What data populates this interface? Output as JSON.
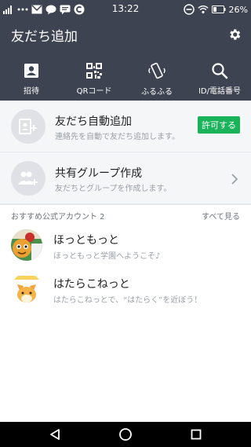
{
  "status_bar": {
    "time": "13:22",
    "battery": "26%",
    "left_icons": [
      "signal-icon",
      "more-dots-icon",
      "mail-icon",
      "chat-bubble-icon",
      "message-icon",
      "app-c-icon"
    ],
    "right_icons": [
      "minus-circle-icon",
      "wifi-icon",
      "battery-icon"
    ]
  },
  "header": {
    "title": "友だち追加",
    "settings_icon": "gear-icon",
    "nav": [
      {
        "label": "招待",
        "icon": "person-card-icon"
      },
      {
        "label": "QRコード",
        "icon": "qr-code-icon"
      },
      {
        "label": "ふるふる",
        "icon": "shake-phone-icon"
      },
      {
        "label": "ID/電話番号",
        "icon": "search-icon"
      }
    ]
  },
  "auto_add": {
    "title": "友だち自動追加",
    "subtitle": "連絡先を自動で友だち追加します。",
    "button_label": "許可する"
  },
  "group_create": {
    "title": "共有グループ作成",
    "subtitle": "友だちとグループを作成します。"
  },
  "official_accounts": {
    "header_label": "おすすめ公式アカウント 2",
    "see_all_label": "すべて見る",
    "items": [
      {
        "name": "ほっともっと",
        "description": "ほっともっと学園へようこそ♪"
      },
      {
        "name": "はたらこねっと",
        "description": "はたらこねっとで、“はたらく”を近ぼう！"
      }
    ]
  },
  "colors": {
    "header_bg": "#3d4350",
    "accent_green": "#19b45a",
    "section_bg": "#f5f6f8"
  },
  "navbar": {
    "icons": [
      "back-triangle-icon",
      "home-circle-icon",
      "recents-square-icon"
    ]
  }
}
